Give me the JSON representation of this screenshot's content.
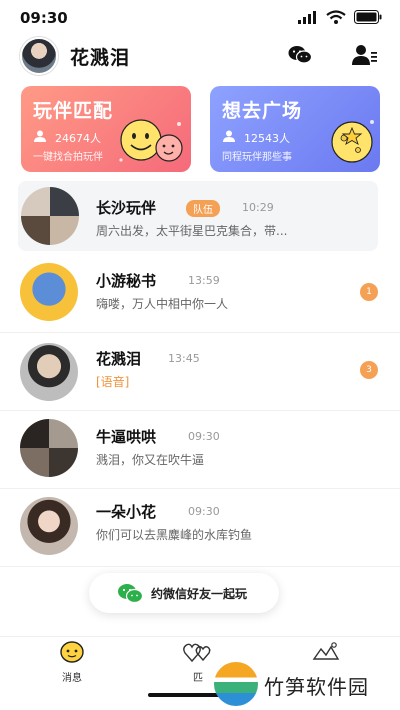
{
  "status_bar": {
    "time": "09:30"
  },
  "header": {
    "title": "花溅泪"
  },
  "cards": [
    {
      "title": "玩伴匹配",
      "count": "24674人",
      "subtitle": "一键找合拍玩伴",
      "color": "#f56a7a"
    },
    {
      "title": "想去广场",
      "count": "12543人",
      "subtitle": "同程玩伴那些事",
      "color": "#6b79f0"
    }
  ],
  "chats": [
    {
      "name": "长沙玩伴",
      "tag": "队伍",
      "time": "10:29",
      "message": "周六出发，太平街星巴克集合，带...",
      "badge": ""
    },
    {
      "name": "小游秘书",
      "tag": "",
      "time": "13:59",
      "message": "嗨喽，万人中相中你一人",
      "badge": "1"
    },
    {
      "name": "花溅泪",
      "tag": "",
      "time": "13:45",
      "message": "[语音]",
      "badge": "3"
    },
    {
      "name": "牛逼哄哄",
      "tag": "",
      "time": "09:30",
      "message": "溅泪，你又在吹牛逼",
      "badge": ""
    },
    {
      "name": "一朵小花",
      "tag": "",
      "time": "09:30",
      "message": "你们可以去黑麋峰的水库钓鱼",
      "badge": ""
    }
  ],
  "invite": {
    "label": "约微信好友一起玩"
  },
  "tabbar": {
    "items": [
      {
        "label": "消息"
      },
      {
        "label": "匹"
      },
      {
        "label": ""
      }
    ]
  },
  "watermark": {
    "text": "竹笋软件园"
  }
}
